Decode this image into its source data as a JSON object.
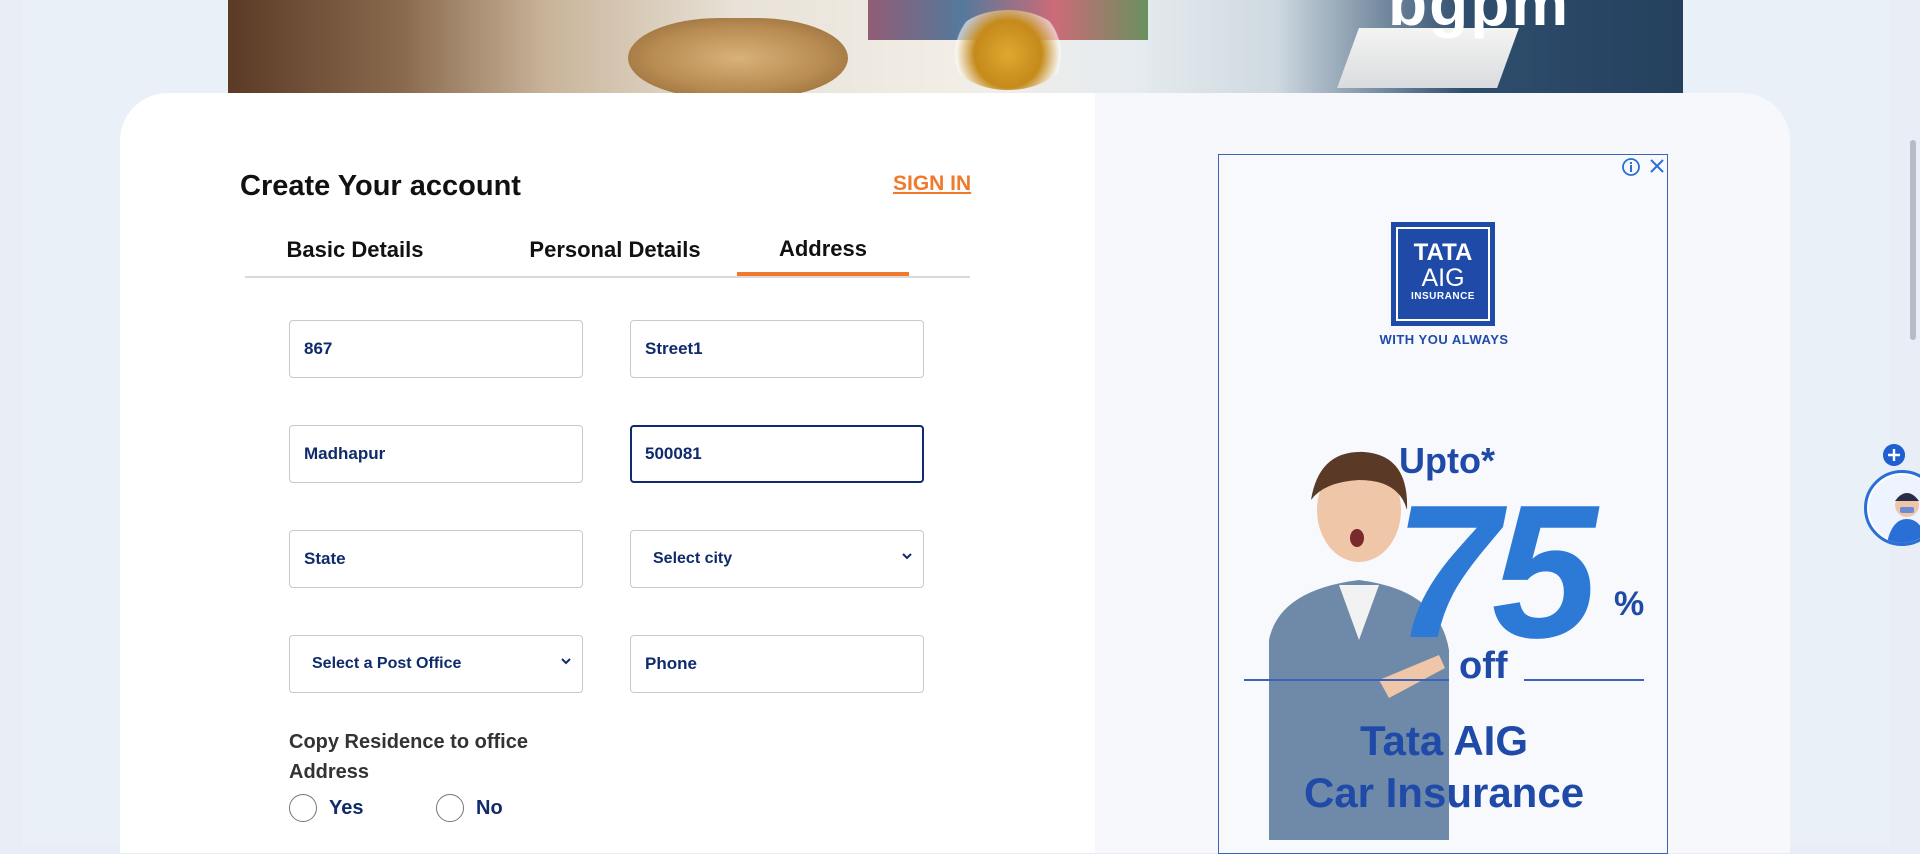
{
  "banner": {
    "brand_text": "bgpm"
  },
  "form": {
    "title": "Create Your account",
    "signin_label": "SIGN IN",
    "tabs": [
      {
        "label": "Basic Details",
        "active": false
      },
      {
        "label": "Personal Details",
        "active": false
      },
      {
        "label": "Address",
        "active": true
      }
    ],
    "fields": {
      "house_no": "867",
      "street": "Street1",
      "area": "Madhapur",
      "pincode": "500081",
      "state": "State",
      "city_select": "Select city",
      "post_office_select": "Select a Post Office",
      "phone": "Phone"
    },
    "copy_address": {
      "label": "Copy Residence to office Address",
      "options": [
        "Yes",
        "No"
      ]
    }
  },
  "ad": {
    "brand_line1": "TATA",
    "brand_line2": "AIG",
    "brand_line3": "INSURANCE",
    "tagline": "WITH YOU ALWAYS",
    "upto": "Upto*",
    "discount": "75",
    "percent": "%",
    "off": "off",
    "product_line1": "Tata AIG",
    "product_line2": "Car Insurance"
  },
  "colors": {
    "accent": "#f07a2b",
    "primary_text": "#0f2b6b",
    "ad_blue": "#1f4aa8"
  }
}
